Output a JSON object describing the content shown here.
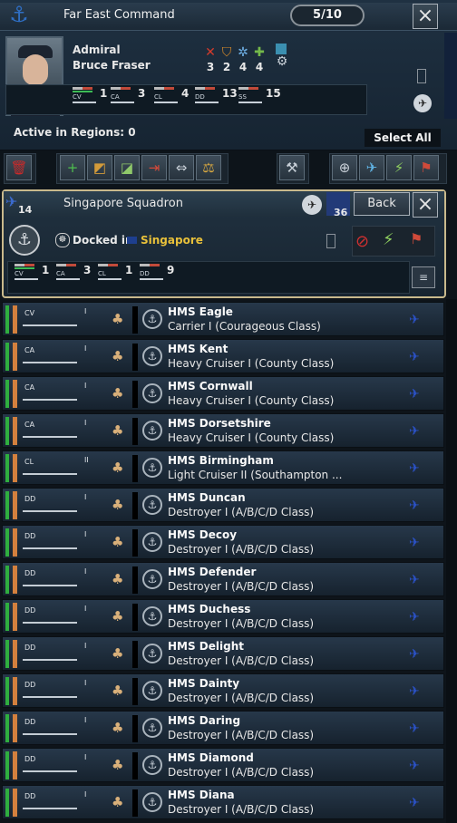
{
  "command": {
    "title": "Far East Command",
    "counter": "5/10",
    "admiral_rank": "Admiral",
    "admiral_name": "Bruce Fraser",
    "skills": [
      {
        "icon": "attack-icon",
        "value": "3"
      },
      {
        "icon": "defense-icon",
        "value": "2"
      },
      {
        "icon": "maneuver-icon",
        "value": "4"
      },
      {
        "icon": "coordination-icon",
        "value": "4"
      }
    ],
    "composition": [
      {
        "cls": "CV",
        "count": "1"
      },
      {
        "cls": "CA",
        "count": "3"
      },
      {
        "cls": "CL",
        "count": "4"
      },
      {
        "cls": "DD",
        "count": "13"
      },
      {
        "cls": "SS",
        "count": "15"
      }
    ],
    "active_regions": "Active in Regions: 0",
    "select_all": "Select All"
  },
  "squadron": {
    "count_left": "14",
    "title": "Singapore Squadron",
    "count_right": "36",
    "back_label": "Back",
    "docked_label": "Docked in",
    "port": "Singapore",
    "composition": [
      {
        "cls": "CV",
        "count": "1"
      },
      {
        "cls": "CA",
        "count": "3"
      },
      {
        "cls": "CL",
        "count": "1"
      },
      {
        "cls": "DD",
        "count": "9"
      }
    ]
  },
  "ships": [
    {
      "name": "HMS Eagle",
      "type": "Carrier I (Courageous Class)",
      "cls": "CV",
      "tier": "I"
    },
    {
      "name": "HMS Kent",
      "type": "Heavy Cruiser I (County Class)",
      "cls": "CA",
      "tier": "I"
    },
    {
      "name": "HMS Cornwall",
      "type": "Heavy Cruiser I (County Class)",
      "cls": "CA",
      "tier": "I"
    },
    {
      "name": "HMS Dorsetshire",
      "type": "Heavy Cruiser I (County Class)",
      "cls": "CA",
      "tier": "I"
    },
    {
      "name": "HMS Birmingham",
      "type": "Light Cruiser II (Southampton ...",
      "cls": "CL",
      "tier": "II"
    },
    {
      "name": "HMS Duncan",
      "type": "Destroyer I (A/B/C/D Class)",
      "cls": "DD",
      "tier": "I"
    },
    {
      "name": "HMS Decoy",
      "type": "Destroyer I (A/B/C/D Class)",
      "cls": "DD",
      "tier": "I"
    },
    {
      "name": "HMS Defender",
      "type": "Destroyer I (A/B/C/D Class)",
      "cls": "DD",
      "tier": "I"
    },
    {
      "name": "HMS Duchess",
      "type": "Destroyer I (A/B/C/D Class)",
      "cls": "DD",
      "tier": "I"
    },
    {
      "name": "HMS Delight",
      "type": "Destroyer I (A/B/C/D Class)",
      "cls": "DD",
      "tier": "I"
    },
    {
      "name": "HMS Dainty",
      "type": "Destroyer I (A/B/C/D Class)",
      "cls": "DD",
      "tier": "I"
    },
    {
      "name": "HMS Daring",
      "type": "Destroyer I (A/B/C/D Class)",
      "cls": "DD",
      "tier": "I"
    },
    {
      "name": "HMS Diamond",
      "type": "Destroyer I (A/B/C/D Class)",
      "cls": "DD",
      "tier": "I"
    },
    {
      "name": "HMS Diana",
      "type": "Destroyer I (A/B/C/D Class)",
      "cls": "DD",
      "tier": "I"
    }
  ],
  "colors": {
    "accent_gold": "#c9b98c",
    "port_yellow": "#e8c03a",
    "plane_blue": "#2b52c9",
    "strength_green": "#2fae3f",
    "org_orange": "#d3803e"
  }
}
